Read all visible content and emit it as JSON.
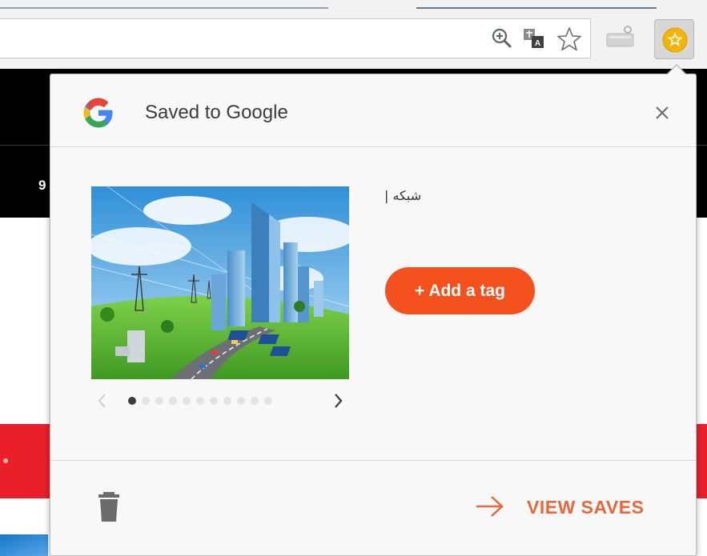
{
  "browser": {
    "page_badge_digit": "9"
  },
  "popup": {
    "title": "Saved to Google",
    "saved_item": {
      "title": "شبکه |",
      "image_description_name": "smart-city-illustration"
    },
    "carousel": {
      "dot_count": 11,
      "active_index": 0
    },
    "add_tag_label": "+ Add a tag",
    "view_saves_label": "VIEW SAVES"
  },
  "colors": {
    "accent_orange": "#f4511e",
    "view_saves_orange": "#e8683b",
    "extension_badge_yellow": "#f4b400"
  },
  "icons": {
    "close": "close-icon",
    "delete": "trash-icon",
    "view_saves": "arrow-right-icon",
    "prev": "chevron-left-icon",
    "next": "chevron-right-icon"
  }
}
